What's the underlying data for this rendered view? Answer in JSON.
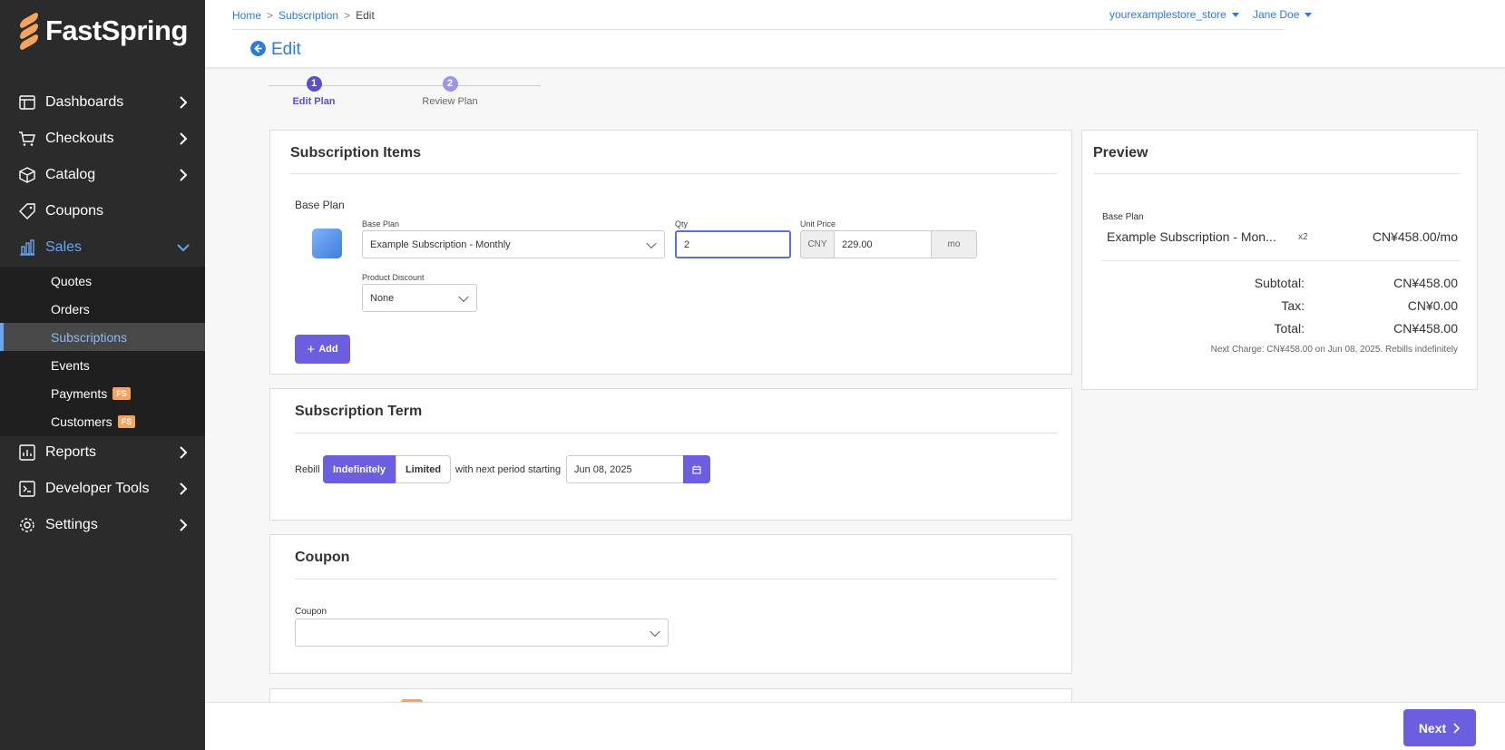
{
  "brand": {
    "name": "FastSpring"
  },
  "nav": {
    "items": [
      {
        "label": "Dashboards",
        "icon": "dashboard-icon"
      },
      {
        "label": "Checkouts",
        "icon": "cart-icon"
      },
      {
        "label": "Catalog",
        "icon": "box-icon"
      },
      {
        "label": "Coupons",
        "icon": "tag-icon"
      },
      {
        "label": "Sales",
        "icon": "bar-chart-icon"
      },
      {
        "label": "Reports",
        "icon": "report-icon"
      },
      {
        "label": "Developer Tools",
        "icon": "terminal-icon"
      },
      {
        "label": "Settings",
        "icon": "gear-icon"
      }
    ],
    "sales_sub": [
      {
        "label": "Quotes"
      },
      {
        "label": "Orders"
      },
      {
        "label": "Subscriptions"
      },
      {
        "label": "Events"
      },
      {
        "label": "Payments",
        "badge": "FS"
      },
      {
        "label": "Customers",
        "badge": "FS"
      }
    ]
  },
  "header": {
    "breadcrumb": [
      "Home",
      "Subscription",
      "Edit"
    ],
    "title": "Edit",
    "store": "yourexamplestore_store",
    "user": "Jane Doe"
  },
  "stepper": {
    "steps": [
      {
        "num": "1",
        "label": "Edit Plan"
      },
      {
        "num": "2",
        "label": "Review Plan"
      }
    ]
  },
  "items_card": {
    "title": "Subscription Items",
    "section_label": "Base Plan",
    "base_plan_label": "Base Plan",
    "base_plan_value": "Example Subscription - Monthly",
    "qty_label": "Qty",
    "qty_value": "2",
    "unit_price_label": "Unit Price",
    "currency": "CNY",
    "unit_price_value": "229.00",
    "period": "mo",
    "discount_label": "Product Discount",
    "discount_value": "None",
    "add_label": "Add"
  },
  "term_card": {
    "title": "Subscription Term",
    "rebill_label": "Rebill",
    "option_indef": "Indefinitely",
    "option_limited": "Limited",
    "next_label": "with next period starting",
    "date_value": "Jun 08, 2025"
  },
  "coupon_card": {
    "title": "Coupon",
    "field_label": "Coupon"
  },
  "preview": {
    "title": "Preview",
    "section_label": "Base Plan",
    "item_name": "Example Subscription - Mon...",
    "item_qty": "x2",
    "item_price": "CN¥458.00/mo",
    "subtotal_label": "Subtotal:",
    "subtotal_value": "CN¥458.00",
    "tax_label": "Tax:",
    "tax_value": "CN¥0.00",
    "total_label": "Total:",
    "total_value": "CN¥458.00",
    "next_charge": "Next Charge: CN¥458.00 on Jun 08, 2025. Rebills indefinitely"
  },
  "footer": {
    "next_label": "Next"
  },
  "colors": {
    "accent": "#6b5fe0",
    "link": "#2f7bd6",
    "sidebar": "#2b2b2b",
    "badge": "#f5a45d"
  }
}
